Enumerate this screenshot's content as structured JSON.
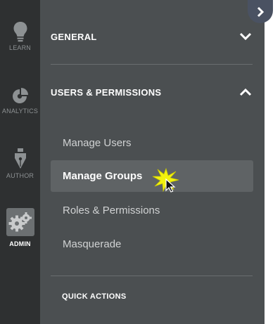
{
  "rail": {
    "items": [
      {
        "label": "LEARN",
        "icon": "lightbulb-icon"
      },
      {
        "label": "ANALYTICS",
        "icon": "pie-chart-icon"
      },
      {
        "label": "AUTHOR",
        "icon": "pen-nib-icon"
      },
      {
        "label": "ADMIN",
        "icon": "gears-icon",
        "active": true
      }
    ]
  },
  "panel": {
    "general": {
      "label": "GENERAL",
      "expanded": false
    },
    "users_permissions": {
      "label": "USERS & PERMISSIONS",
      "expanded": true,
      "items": [
        {
          "label": "Manage Users"
        },
        {
          "label": "Manage Groups",
          "selected": true
        },
        {
          "label": "Roles & Permissions"
        },
        {
          "label": "Masquerade"
        }
      ]
    },
    "quick_actions": {
      "label": "QUICK ACTIONS"
    }
  },
  "colors": {
    "rail_bg": "#2e3031",
    "panel_bg": "#4b4f51",
    "selected_bg": "#5f6365",
    "collapse_button": "#4a5262",
    "click_highlight": "#f2f20e"
  }
}
